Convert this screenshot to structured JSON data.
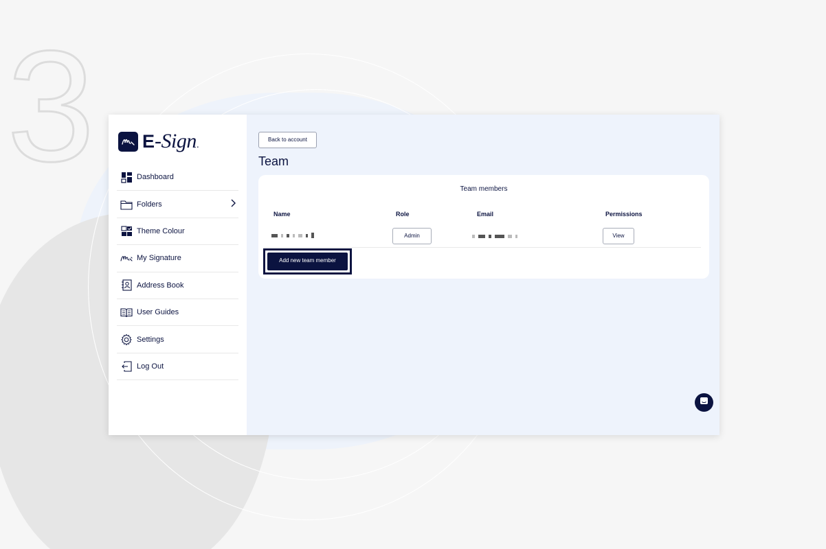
{
  "step": "3",
  "brand": {
    "name_bold": "E",
    "name_script": "-Sign",
    "name_dot": "."
  },
  "sidebar": {
    "items": [
      {
        "label": "Dashboard",
        "icon": "dashboard-icon"
      },
      {
        "label": "Folders",
        "icon": "folder-icon",
        "has_chevron": true
      },
      {
        "label": "Theme Colour",
        "icon": "theme-icon"
      },
      {
        "label": "My Signature",
        "icon": "signature-icon"
      },
      {
        "label": "Address Book",
        "icon": "address-book-icon"
      },
      {
        "label": "User Guides",
        "icon": "book-icon"
      },
      {
        "label": "Settings",
        "icon": "gear-icon"
      },
      {
        "label": "Log Out",
        "icon": "logout-icon"
      }
    ]
  },
  "main": {
    "back_label": "Back to account",
    "title": "Team",
    "card": {
      "title": "Team members",
      "columns": [
        "Name",
        "Role",
        "Email",
        "Permissions"
      ],
      "rows": [
        {
          "role": "Admin",
          "permissions": "View"
        }
      ],
      "add_label": "Add new team member"
    }
  },
  "colors": {
    "primary": "#0b1340",
    "main_bg": "#eef3fc",
    "page_bg": "#f6f6f6"
  }
}
